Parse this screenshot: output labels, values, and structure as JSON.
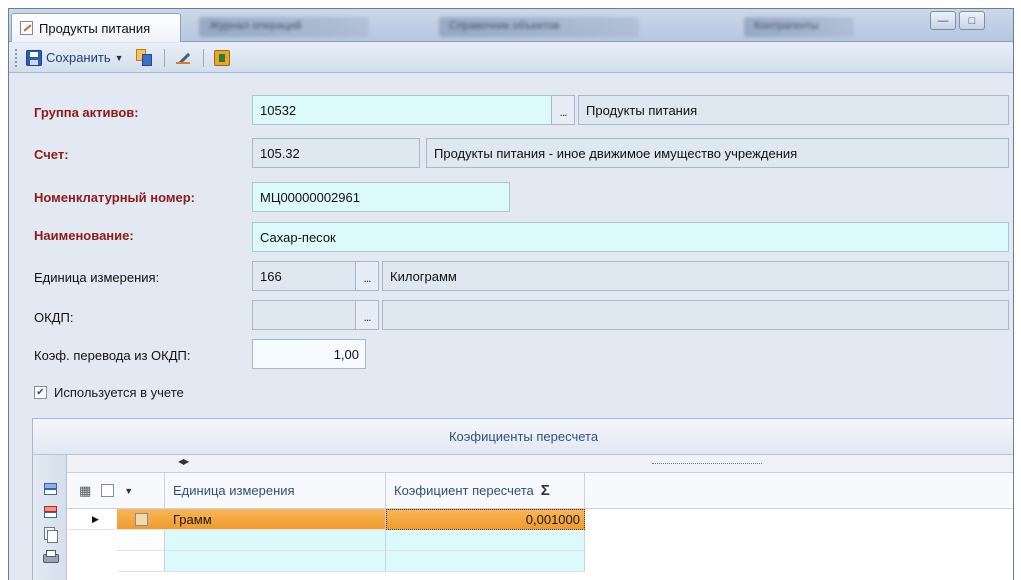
{
  "window": {
    "active_tab": "Продукты питания",
    "blurred_tabs": [
      "Журнал операций",
      "Справочник объектов",
      "Контрагенты"
    ]
  },
  "toolbar": {
    "save_label": "Сохранить"
  },
  "form": {
    "asset_group": {
      "label": "Группа активов:",
      "code": "10532",
      "name": "Продукты питания"
    },
    "account": {
      "label": "Счет:",
      "code": "105.32",
      "name": "Продукты питания - иное движимое имущество учреждения"
    },
    "nomenclature_number": {
      "label": "Номенклатурный номер:",
      "value": "МЦ00000002961"
    },
    "name": {
      "label": "Наименование:",
      "value": "Сахар-песок"
    },
    "unit": {
      "label": "Единица измерения:",
      "code": "166",
      "name": "Килограмм"
    },
    "okdp": {
      "label": "ОКДП:",
      "code": "",
      "name": ""
    },
    "okdp_coef": {
      "label": "Коэф. перевода из ОКДП:",
      "value": "1,00"
    },
    "used_in_accounting": {
      "label": "Используется в учете",
      "checked": true
    }
  },
  "grid": {
    "title": "Коэфициенты пересчета",
    "columns": [
      "Единица измерения",
      "Коэфициент пересчета"
    ],
    "rows": [
      {
        "unit": "Грамм",
        "coef": "0,001000",
        "selected": true
      }
    ],
    "ellipsis": "..."
  },
  "colors": {
    "required_label": "#8e1b17",
    "selected_row": "#f19b2a",
    "editable_field": "#dcfafb"
  }
}
